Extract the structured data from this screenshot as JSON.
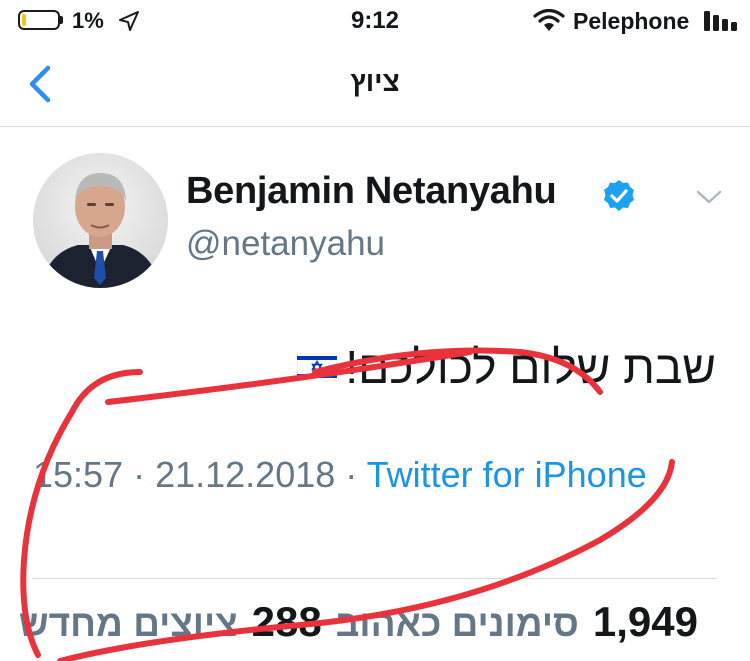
{
  "status_bar": {
    "battery_percent": "1%",
    "time": "9:12",
    "carrier": "Pelephone"
  },
  "nav": {
    "title": "ציוץ",
    "back_icon": "chevron-left-icon"
  },
  "tweet": {
    "display_name": "Benjamin Netanyahu",
    "handle": "@netanyahu",
    "verified": true,
    "text": "שבת שלום לכולכם!",
    "emoji": "israel-flag",
    "time": "15:57",
    "date": "21.12.2018",
    "separator": " · ",
    "source": "Twitter for iPhone",
    "stats": {
      "likes_count": "1,949",
      "likes_label": "סימונים כאהוב",
      "retweets_count": "288",
      "retweets_label": "ציוצים מחדש"
    }
  },
  "colors": {
    "link_blue": "#1b95e0",
    "secondary_text": "#657786",
    "ios_blue": "#2f8ef1",
    "annotation_red": "#e8333c"
  }
}
